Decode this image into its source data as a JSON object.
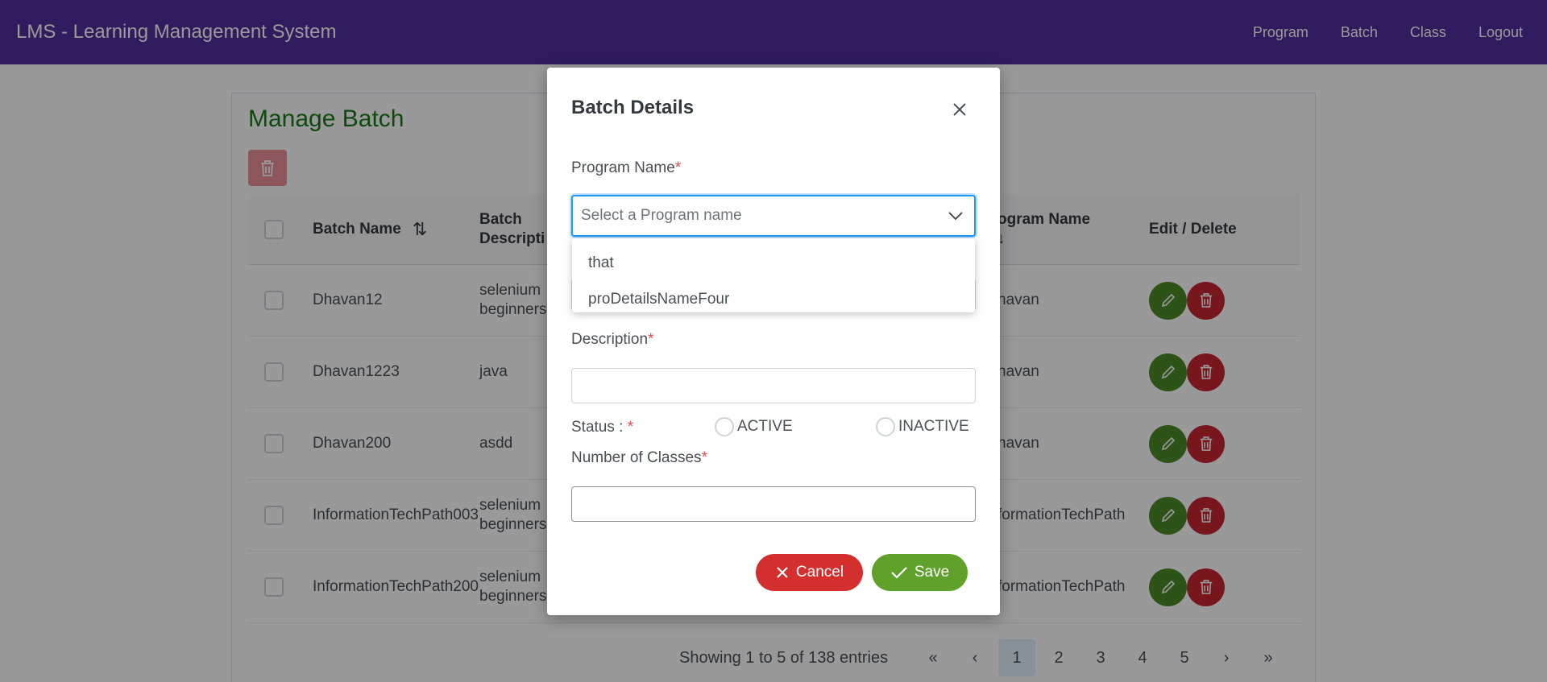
{
  "app": {
    "title": "LMS - Learning Management System"
  },
  "nav": {
    "items": [
      "Program",
      "Batch",
      "Class",
      "Logout"
    ]
  },
  "page": {
    "title": "Manage Batch"
  },
  "table": {
    "headers": {
      "batch_name": "Batch Name",
      "batch_description_line1": "Batch",
      "batch_description_line2": "Descripti",
      "program_name": "ogram Name",
      "program_sort": "↓",
      "edit_delete": "Edit / Delete"
    },
    "rows": [
      {
        "name": "Dhavan12",
        "desc1": "selenium",
        "desc2": "beginners",
        "program": "havan"
      },
      {
        "name": "Dhavan1223",
        "desc1": "java",
        "desc2": "",
        "program": "havan"
      },
      {
        "name": "Dhavan200",
        "desc1": "asdd",
        "desc2": "",
        "program": "havan"
      },
      {
        "name": "InformationTechPath003",
        "desc1": "selenium",
        "desc2": "beginners",
        "program": "formationTechPath"
      },
      {
        "name": "InformationTechPath200",
        "desc1": "selenium",
        "desc2": "beginners",
        "program": "formationTechPath"
      }
    ]
  },
  "pagination": {
    "info": "Showing 1 to 5 of 138 entries",
    "pages": [
      "1",
      "2",
      "3",
      "4",
      "5"
    ],
    "active_page": "1",
    "first": "«",
    "prev": "‹",
    "next": "›",
    "last": "»"
  },
  "modal": {
    "title": "Batch Details",
    "program_label": "Program Name",
    "required_mark": "*",
    "program_placeholder": "Select a Program name",
    "program_options": [
      "that",
      "proDetailsNameFour"
    ],
    "description_label": "Description",
    "status_label": "Status : ",
    "status_active": "ACTIVE",
    "status_inactive": "INACTIVE",
    "classes_label": "Number of Classes",
    "cancel": "Cancel",
    "save": "Save"
  },
  "colors": {
    "navbar": "#4f2d9c",
    "title_green": "#1a7a1a",
    "cancel_red": "#d32f2f",
    "save_green": "#5fa12a",
    "focus_blue": "#2196f3"
  },
  "icons": {
    "close": "close-icon",
    "chevron": "chevron-down-icon",
    "sort": "sort-icon",
    "edit": "pencil-icon",
    "delete": "trash-icon",
    "cancel": "x-icon",
    "save": "check-icon"
  }
}
